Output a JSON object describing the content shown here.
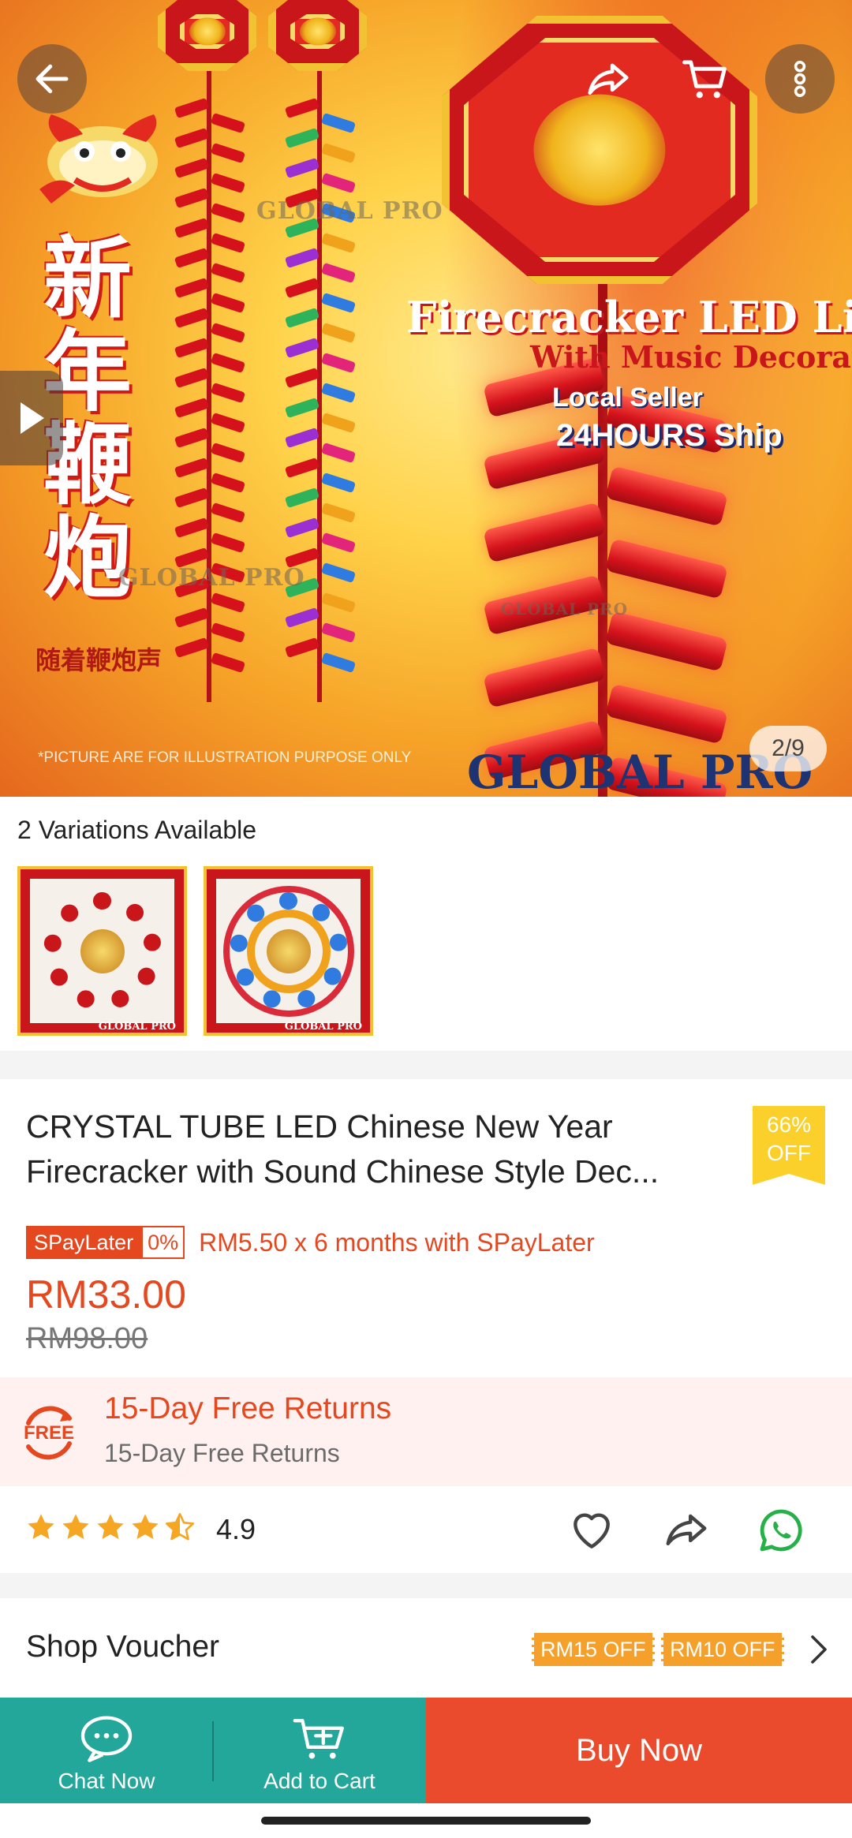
{
  "hero": {
    "chinese_title": "新年鞭炮",
    "chinese_subtitle": "随着鞭炮声",
    "watermark": "GLOBAL PRO",
    "promo_title": "Firecracker LED Light",
    "promo_subtitle": "With Music Decorations",
    "local_seller": "Local Seller",
    "shipping": "24HOURS Ship",
    "disclaimer": "*PICTURE ARE FOR ILLUSTRATION PURPOSE ONLY",
    "brand": "GLOBAL PRO",
    "page_counter": "2/9"
  },
  "icons": {
    "back": "arrow-left-icon",
    "share": "share-icon",
    "cart": "cart-icon",
    "more": "more-vertical-icon",
    "video": "play-icon"
  },
  "variations": {
    "title": "2 Variations Available",
    "items": [
      {
        "tag": "GLOBAL PRO"
      },
      {
        "tag": "GLOBAL PRO"
      }
    ]
  },
  "product": {
    "title_line1": "CRYSTAL TUBE LED Chinese New Year",
    "title_line2": "Firecracker with Sound Chinese Style Dec...",
    "discount_pct": "66%",
    "discount_word": "OFF",
    "spaylater_label": "SPayLater",
    "spaylater_rate": "0%",
    "spaylater_text": "RM5.50 x 6 months with SPayLater",
    "price": "RM33.00",
    "original_price": "RM98.00"
  },
  "returns": {
    "badge": "FREE",
    "title": "15-Day Free Returns",
    "subtitle": "15-Day Free Returns"
  },
  "rating": {
    "value": "4.9",
    "stars": 4.5
  },
  "voucher": {
    "title": "Shop Voucher",
    "tags": [
      "RM15 OFF",
      "RM10 OFF"
    ]
  },
  "bottom_bar": {
    "chat_label": "Chat Now",
    "cart_label": "Add to Cart",
    "buy_label": "Buy Now"
  },
  "colors": {
    "accent": "#E5481F",
    "teal": "#23A79A",
    "buy": "#EA4B2C",
    "badge_yellow": "#FBD02A",
    "voucher_orange": "#F5A02A",
    "star": "#F5A623",
    "whatsapp": "#25B147"
  }
}
